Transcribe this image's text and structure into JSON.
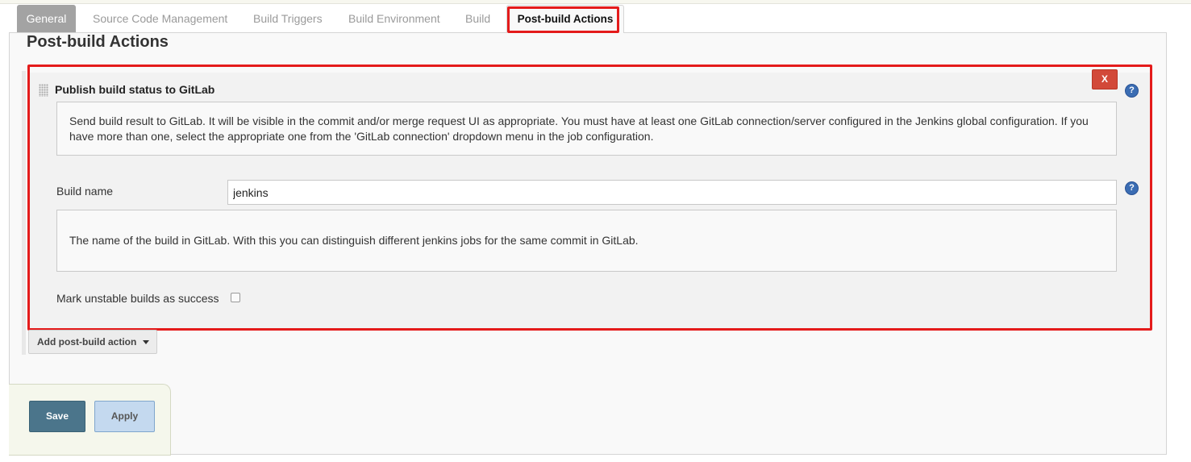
{
  "tabs": [
    {
      "label": "General"
    },
    {
      "label": "Source Code Management"
    },
    {
      "label": "Build Triggers"
    },
    {
      "label": "Build Environment"
    },
    {
      "label": "Build"
    },
    {
      "label": "Post-build Actions",
      "active": true
    }
  ],
  "section": {
    "title": "Post-build Actions"
  },
  "publisher": {
    "title": "Publish build status to GitLab",
    "delete_label": "X",
    "help_icon": "?",
    "help_text": "Send build result to GitLab. It will be visible in the commit and/or merge request UI as appropriate. You must have at least one GitLab connection/server configured in the Jenkins global configuration. If you have more than one, select the appropriate one from the 'GitLab connection' dropdown menu in the job configuration.",
    "build_name": {
      "label": "Build name",
      "value": "jenkins",
      "help_icon": "?",
      "help_text": "The name of the build in GitLab. With this you can distinguish different jenkins jobs for the same commit in GitLab."
    },
    "mark_unstable": {
      "label": "Mark unstable builds as success",
      "checked": false
    }
  },
  "add_action": {
    "label": "Add post-build action"
  },
  "buttons": {
    "save": "Save",
    "apply": "Apply"
  },
  "colors": {
    "highlight": "#e41b1b",
    "save_bg": "#4b758b",
    "apply_bg": "#c4d9ef",
    "delete_bg": "#d24939",
    "help_icon": "#3b6db3"
  }
}
